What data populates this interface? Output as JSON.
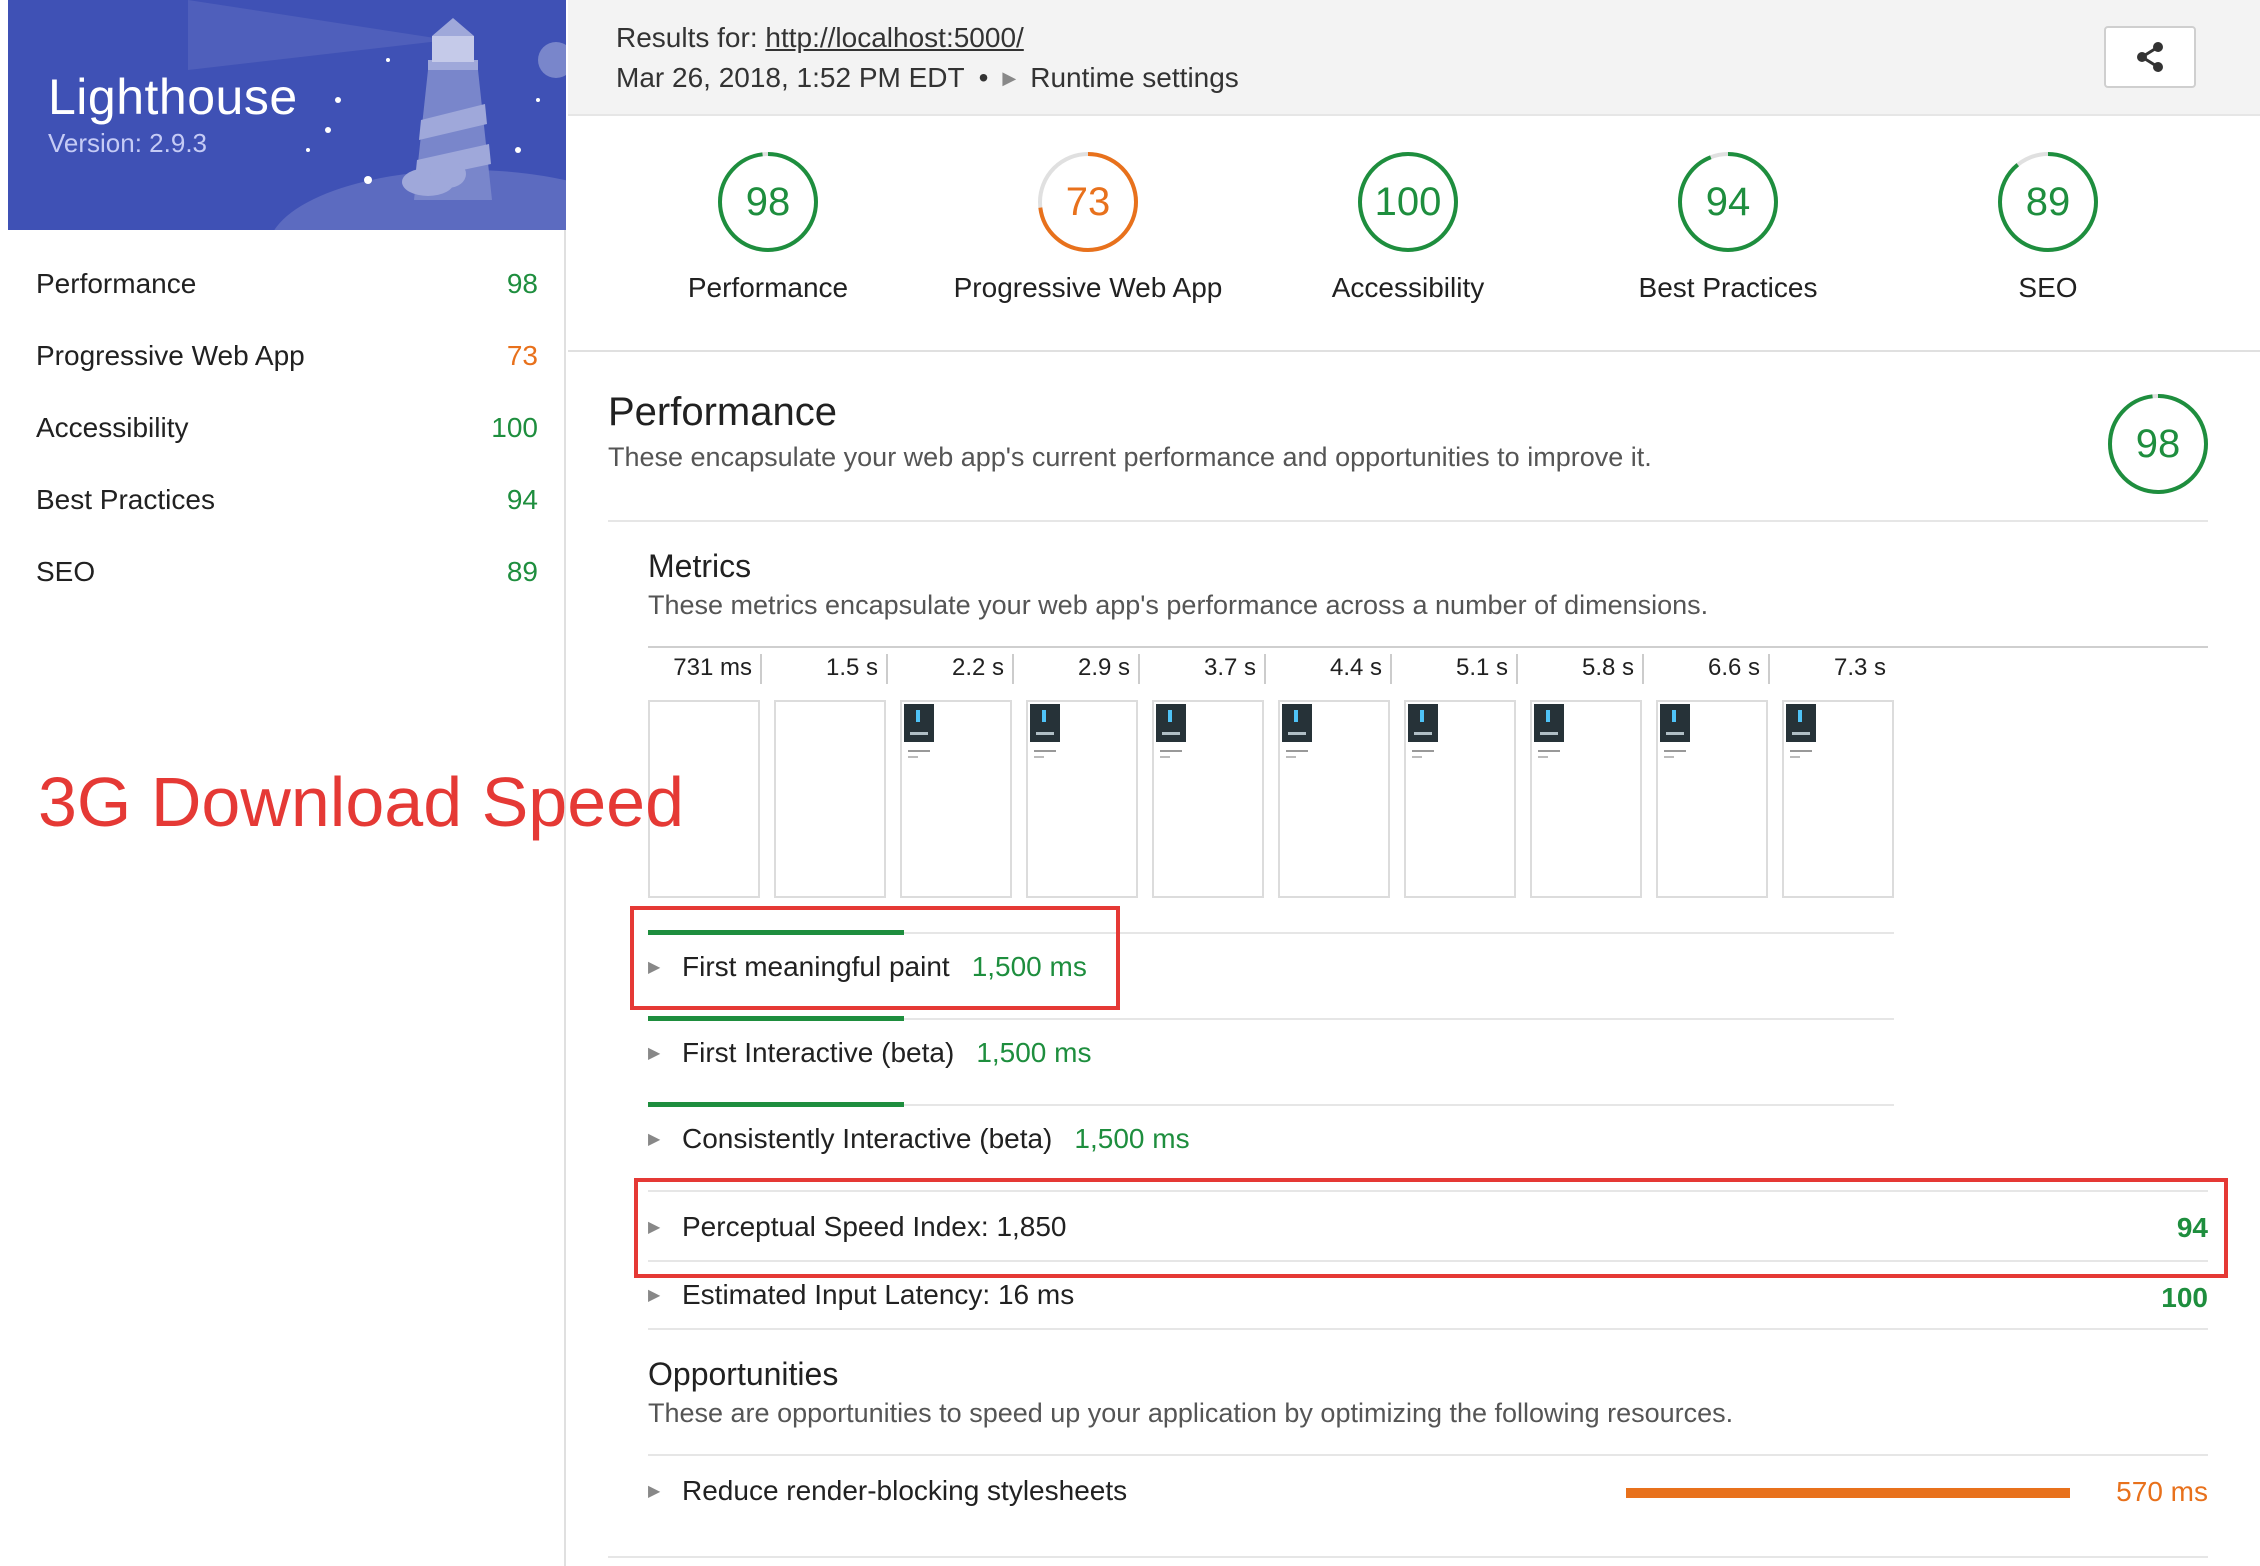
{
  "sidebar": {
    "app_title": "Lighthouse",
    "version": "Version: 2.9.3",
    "items": [
      {
        "label": "Performance",
        "score": "98",
        "color": "#1e8e3e"
      },
      {
        "label": "Progressive Web App",
        "score": "73",
        "color": "#e8711c"
      },
      {
        "label": "Accessibility",
        "score": "100",
        "color": "#1e8e3e"
      },
      {
        "label": "Best Practices",
        "score": "94",
        "color": "#1e8e3e"
      },
      {
        "label": "SEO",
        "score": "89",
        "color": "#1e8e3e"
      }
    ]
  },
  "topbar": {
    "results_for_label": "Results for:",
    "url": "http://localhost:5000/",
    "date": "Mar 26, 2018, 1:52 PM EDT",
    "separator": "•",
    "runtime_settings": "Runtime settings",
    "share_icon": "share-icon"
  },
  "gauges": [
    {
      "score": "98",
      "label": "Performance",
      "fraction": 0.98,
      "color": "#1e8e3e"
    },
    {
      "score": "73",
      "label": "Progressive Web App",
      "fraction": 0.73,
      "color": "#e8711c"
    },
    {
      "score": "100",
      "label": "Accessibility",
      "fraction": 1.0,
      "color": "#1e8e3e"
    },
    {
      "score": "94",
      "label": "Best Practices",
      "fraction": 0.94,
      "color": "#1e8e3e"
    },
    {
      "score": "89",
      "label": "SEO",
      "fraction": 0.89,
      "color": "#1e8e3e"
    }
  ],
  "performance": {
    "title": "Performance",
    "description": "These encapsulate your web app's current performance and opportunities to improve it.",
    "score": "98",
    "fraction": 0.98
  },
  "metrics": {
    "title": "Metrics",
    "description": "These metrics encapsulate your web app's performance across a number of dimensions.",
    "filmstrip": [
      "731 ms",
      "1.5 s",
      "2.2 s",
      "2.9 s",
      "3.7 s",
      "4.4 s",
      "5.1 s",
      "5.8 s",
      "6.6 s",
      "7.3 s"
    ],
    "frame_has_content": [
      false,
      false,
      true,
      true,
      true,
      true,
      true,
      true,
      true,
      true
    ],
    "rows": [
      {
        "label": "First meaningful paint",
        "value": "1,500 ms"
      },
      {
        "label": "First Interactive (beta)",
        "value": "1,500 ms"
      },
      {
        "label": "Consistently Interactive (beta)",
        "value": "1,500 ms"
      },
      {
        "label": "Perceptual Speed Index: 1,850",
        "score": "94"
      },
      {
        "label": "Estimated Input Latency: 16 ms",
        "score": "100"
      }
    ]
  },
  "opportunities": {
    "title": "Opportunities",
    "description": "These are opportunities to speed up your application by optimizing the following resources.",
    "items": [
      {
        "label": "Reduce render-blocking stylesheets",
        "value": "570 ms"
      }
    ]
  },
  "annotation": {
    "caption": "3G Download Speed",
    "color": "#e53935"
  }
}
